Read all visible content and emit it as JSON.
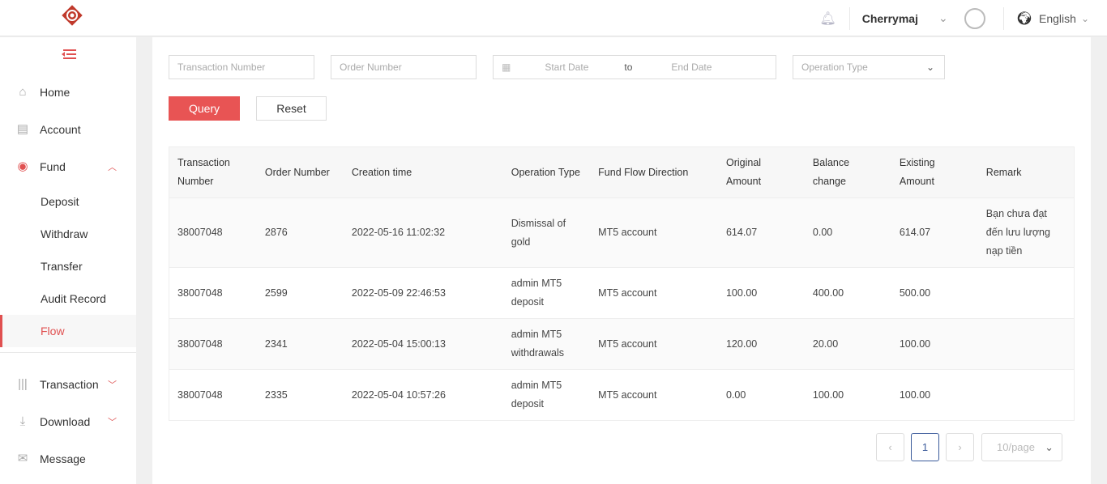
{
  "header": {
    "user": "Cherrymaj",
    "language": "English"
  },
  "sidebar": {
    "items": [
      {
        "label": "Home",
        "icon": "home-icon"
      },
      {
        "label": "Account",
        "icon": "account-icon"
      },
      {
        "label": "Fund",
        "icon": "fund-icon",
        "expanded": true,
        "children": [
          "Deposit",
          "Withdraw",
          "Transfer",
          "Audit Record",
          "Flow"
        ]
      },
      {
        "label": "Transaction",
        "icon": "barcode-icon"
      },
      {
        "label": "Download",
        "icon": "download-icon"
      },
      {
        "label": "Message",
        "icon": "mail-icon"
      }
    ],
    "active": "Flow"
  },
  "filters": {
    "transaction_number": "Transaction Number",
    "order_number": "Order Number",
    "start_date": "Start Date",
    "to": "to",
    "end_date": "End Date",
    "operation_type": "Operation Type",
    "query": "Query",
    "reset": "Reset"
  },
  "table": {
    "headers": [
      "Transaction Number",
      "Order Number",
      "Creation time",
      "Operation Type",
      "Fund Flow Direction",
      "Original Amount",
      "Balance change",
      "Existing Amount",
      "Remark"
    ],
    "rows": [
      [
        "38007048",
        "2876",
        "2022-05-16 11:02:32",
        "Dismissal of gold",
        "MT5 account",
        "614.07",
        "0.00",
        "614.07",
        "Bạn chưa đạt đến lưu lượng nạp tiền"
      ],
      [
        "38007048",
        "2599",
        "2022-05-09 22:46:53",
        "admin MT5 deposit",
        "MT5 account",
        "100.00",
        "400.00",
        "500.00",
        ""
      ],
      [
        "38007048",
        "2341",
        "2022-05-04 15:00:13",
        "admin MT5 withdrawals",
        "MT5 account",
        "120.00",
        "20.00",
        "100.00",
        ""
      ],
      [
        "38007048",
        "2335",
        "2022-05-04 10:57:26",
        "admin MT5 deposit",
        "MT5 account",
        "0.00",
        "100.00",
        "100.00",
        ""
      ]
    ]
  },
  "pagination": {
    "current": "1",
    "page_size": "10/page"
  },
  "colors": {
    "accent": "#e85454"
  }
}
